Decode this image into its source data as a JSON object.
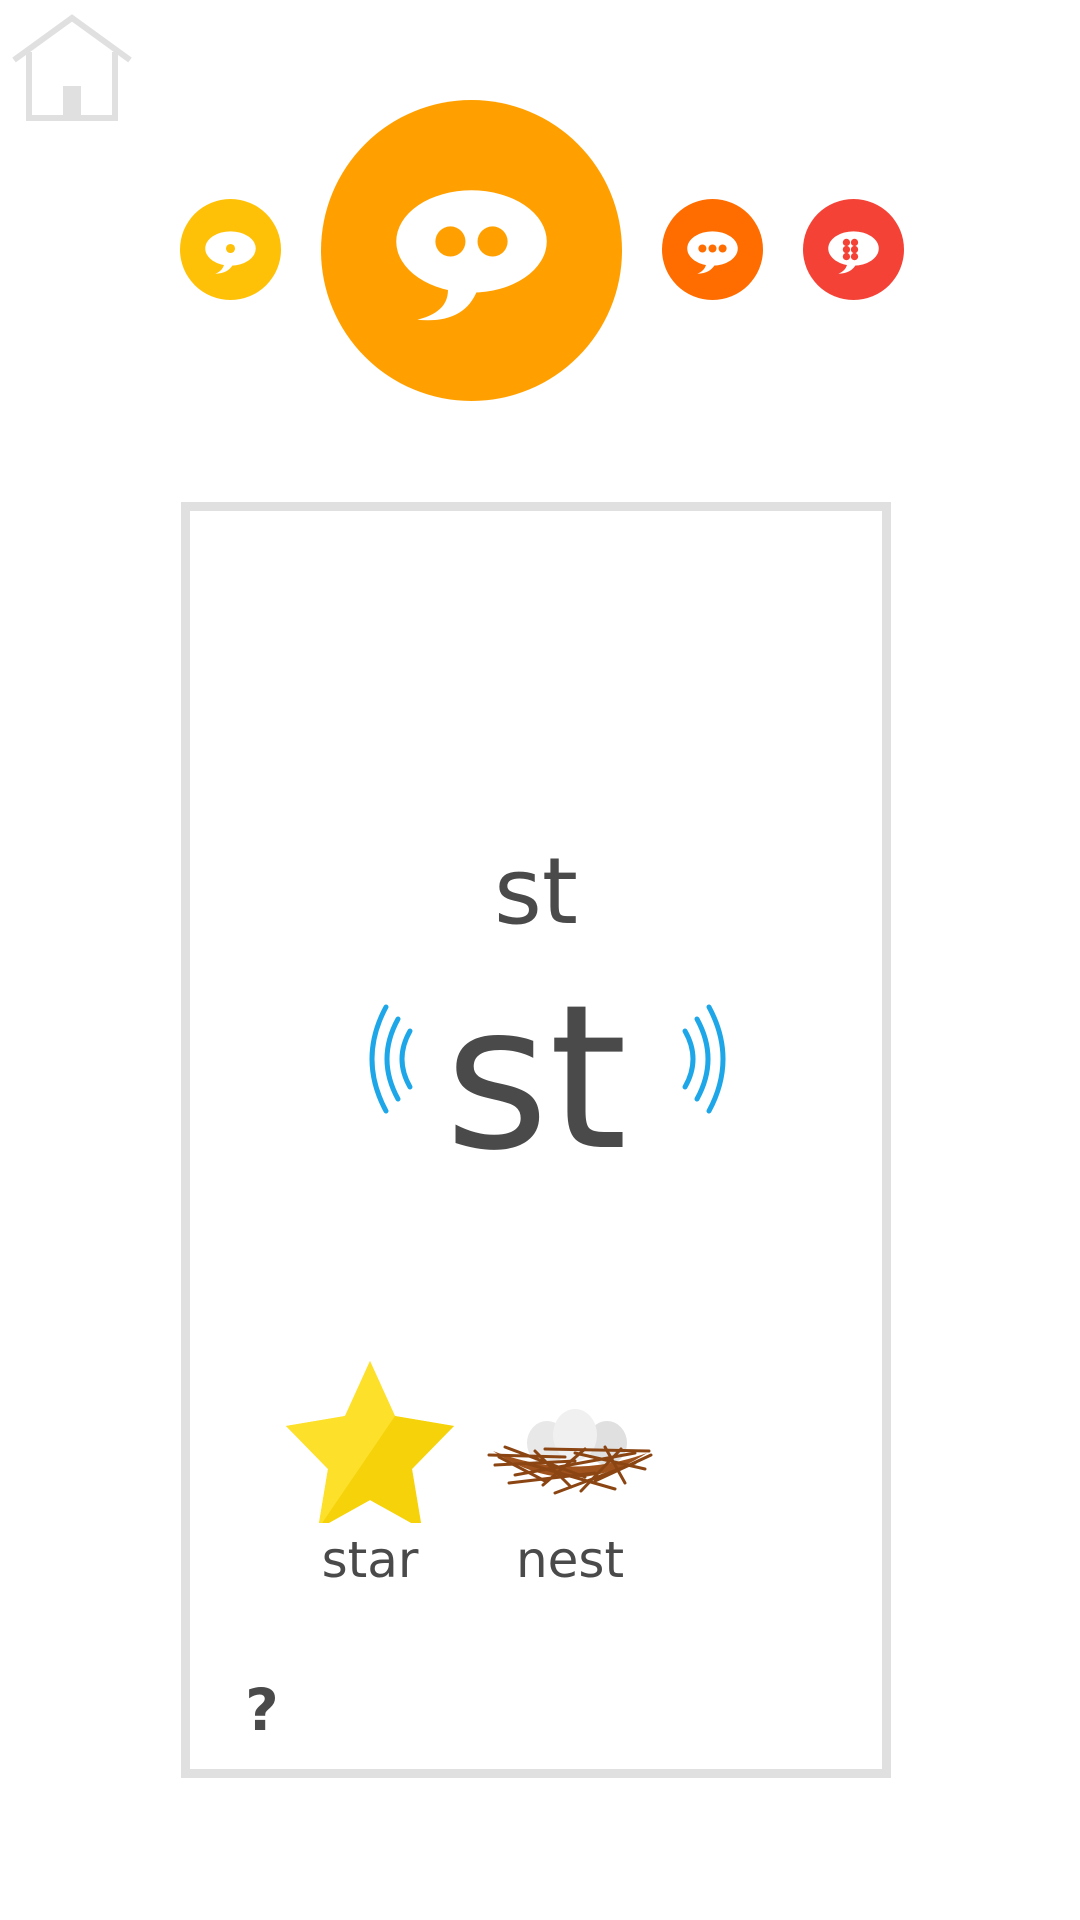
{
  "nav": {
    "home_icon": "home-icon"
  },
  "levels": [
    {
      "id": "level-1",
      "color": "#FFC107",
      "dots": 1,
      "icon": "speech-bubble-one-dot-icon"
    },
    {
      "id": "level-2",
      "color": "#FFA000",
      "dots": 2,
      "icon": "speech-bubble-two-dots-icon",
      "selected": true
    },
    {
      "id": "level-3",
      "color": "#FF6D00",
      "dots": 3,
      "icon": "speech-bubble-three-dots-icon"
    },
    {
      "id": "level-4",
      "color": "#F44336",
      "dots": 6,
      "icon": "speech-bubble-six-dots-icon"
    }
  ],
  "card": {
    "grapheme_small": "st",
    "grapheme_large": "st",
    "sound_icon_color": "#1EA7E8",
    "words": [
      {
        "label": "star",
        "image": "star-image"
      },
      {
        "label": "nest",
        "image": "nest-image"
      }
    ],
    "help_label": "?"
  },
  "colors": {
    "text": "#4A4A4A",
    "card_border": "#E0E0E0",
    "home_icon": "#E0E0E0"
  }
}
